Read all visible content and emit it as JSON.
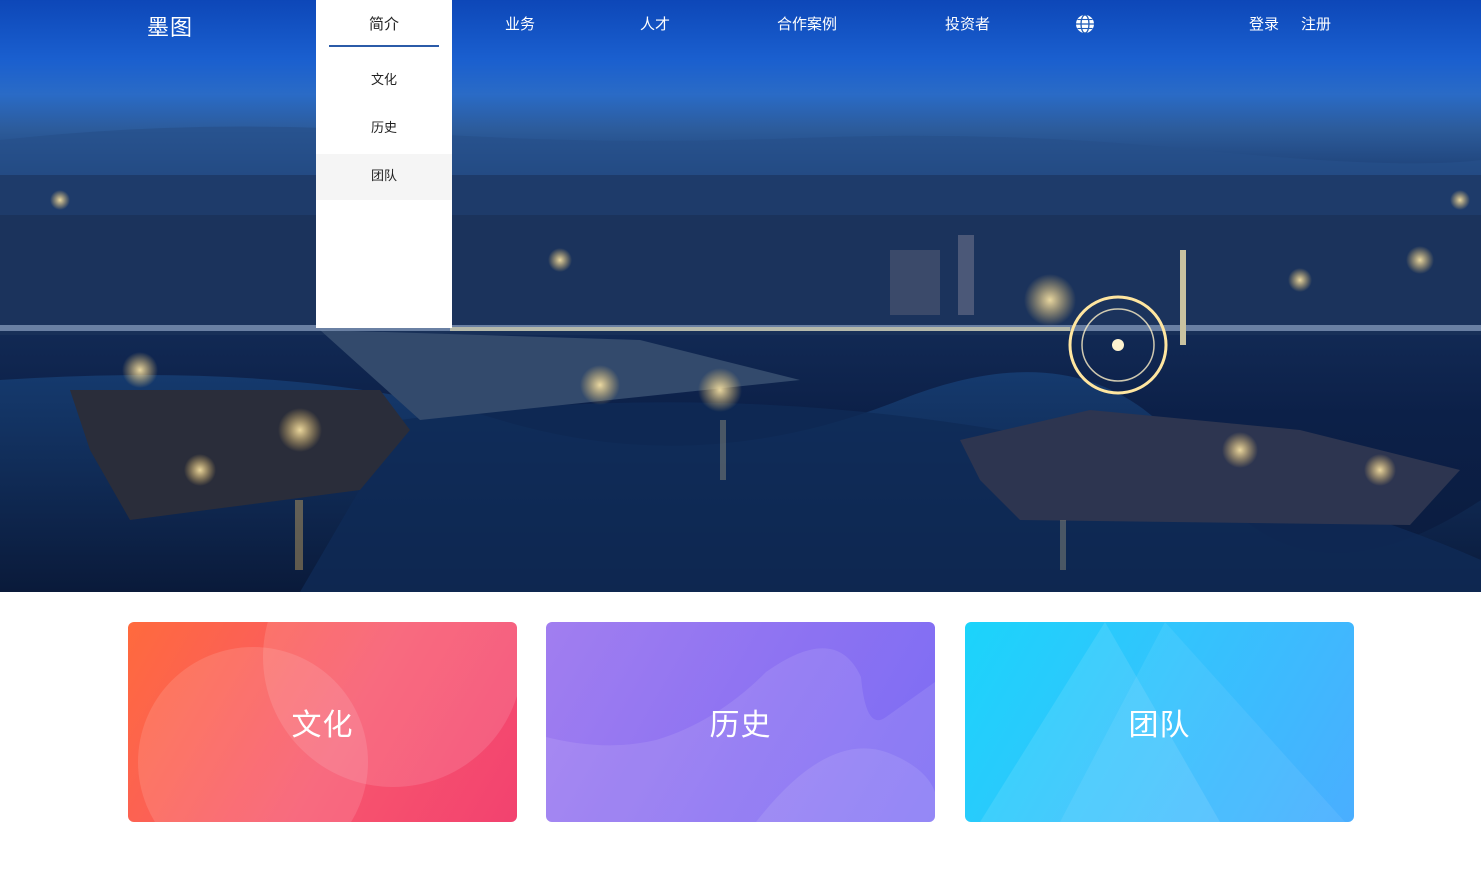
{
  "nav": {
    "logo": "墨图",
    "items": [
      "简介",
      "业务",
      "人才",
      "合作案例",
      "投资者"
    ],
    "login": "登录",
    "register": "注册",
    "globe_icon": "globe-icon"
  },
  "dropdown": {
    "head": "简介",
    "items": [
      "文化",
      "历史",
      "团队"
    ],
    "active_index": 2
  },
  "cards": [
    {
      "title": "文化",
      "color": "#f8576e"
    },
    {
      "title": "历史",
      "color": "#8c72f2"
    },
    {
      "title": "团队",
      "color": "#35c2fd"
    }
  ]
}
